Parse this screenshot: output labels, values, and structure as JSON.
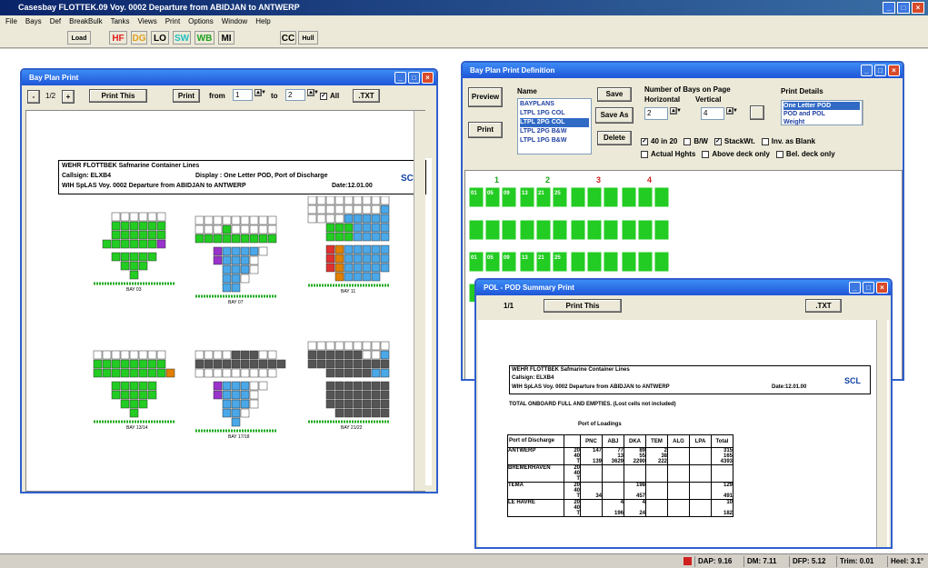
{
  "app": {
    "title": "Casesbay FLOTTEK.09  Voy. 0002 Departure from ABIDJAN to ANTWERP",
    "controls": [
      "_",
      "□",
      "×"
    ]
  },
  "menu": [
    "File",
    "Bays",
    "Def",
    "BreakBulk",
    "Tanks",
    "Views",
    "Print",
    "Options",
    "Window",
    "Help"
  ],
  "toolbar": {
    "load": "Load",
    "buttons": [
      {
        "label": "HF",
        "color": "#e02020"
      },
      {
        "label": "DG",
        "color": "#e0a020"
      },
      {
        "label": "LO",
        "color": "#000000"
      },
      {
        "label": "SW",
        "color": "#20c0c0"
      },
      {
        "label": "WB",
        "color": "#20a020"
      },
      {
        "label": "MI",
        "color": "#000000"
      },
      {
        "label": "CC",
        "color": "#000000"
      },
      {
        "label": "Hull",
        "color": "#000000"
      }
    ]
  },
  "bay_plan_window": {
    "title": "Bay Plan Print",
    "page": "1/2",
    "print_this": "Print This",
    "print": "Print",
    "from_label": "from",
    "from_value": "1",
    "to_label": "to",
    "to_value": "2",
    "all_label": "All",
    "txt": ".TXT",
    "header": {
      "ship": "WEHR FLOTTBEK   Safmarine Container Lines",
      "callsign": "Callsign: ELXB4",
      "display": "Display : One Letter POD, Port of Discharge",
      "voyage": "WIH SpLAS  Voy. 0002  Departure from ABIDJAN  to ANTWERP",
      "date": "Date:12.01.00",
      "logo": "SCL"
    },
    "bay_labels_top": [
      "BAY 01/02",
      "BAY 05/06",
      "BAY 09/10"
    ],
    "bay_labels_mid": [
      "BAY 03",
      "BAY 07",
      "BAY 11"
    ],
    "bay_labels_bottom": [
      "BAY 13/14",
      "BAY 17/18",
      "BAY 21/22"
    ]
  },
  "definition_window": {
    "title": "Bay Plan Print Definition",
    "preview": "Preview",
    "print": "Print",
    "name_label": "Name",
    "names": [
      "BAYPLANS",
      "LTPL 1PG COL",
      "LTPL 2PG COL",
      "LTPL 2PG B&W",
      "LTPL 1PG B&W"
    ],
    "selected_name": "LTPL 2PG COL",
    "save": "Save",
    "save_as": "Save As",
    "delete": "Delete",
    "bays_heading": "Number of Bays on Page",
    "horizontal_label": "Horizontal",
    "vertical_label": "Vertical",
    "horizontal_value": "2",
    "vertical_value": "4",
    "print_details_label": "Print Details",
    "print_details": [
      "One Letter POD",
      "POD and POL",
      "Weight"
    ],
    "selected_detail": "One Letter POD",
    "checkboxes": [
      {
        "label": "40 in 20",
        "checked": true
      },
      {
        "label": "B/W",
        "checked": false
      },
      {
        "label": "StackWt.",
        "checked": true
      },
      {
        "label": "Inv. as Blank",
        "checked": false
      },
      {
        "label": "Actual Hghts",
        "checked": false
      },
      {
        "label": "Above deck only",
        "checked": false
      },
      {
        "label": "Bel. deck only",
        "checked": false
      }
    ],
    "page_numbers": [
      "1",
      "2",
      "3",
      "4"
    ],
    "cell_codes": [
      "01",
      "05",
      "09",
      "13",
      "21",
      "25",
      "29",
      "33",
      "02",
      "06",
      "10",
      "14",
      "22",
      "26",
      "30",
      "34"
    ]
  },
  "summary_window": {
    "title": "POL - POD Summary Print",
    "page": "1/1",
    "print_this": "Print This",
    "txt": ".TXT",
    "header": {
      "ship": "WEHR FLOTTBEK   Safmarine Container Lines",
      "callsign": "Callsign: ELXB4",
      "voyage": "WIH SpLAS  Voy. 0002  Departure from ABIDJAN   to ANTWERP",
      "date": "Date:12.01.00",
      "logo": "SCL"
    },
    "total_line": "TOTAL ONBOARD   FULL AND EMPTIES.  (Lost cells not included)",
    "loading_label": "Port of Loadings",
    "discharge_label": "Port of Discharge",
    "columns": [
      "PNC",
      "ABJ",
      "DKA",
      "TEM",
      "ALG",
      "LPA",
      "Total"
    ],
    "rows": [
      {
        "port": "ANTWERP",
        "sizes": [
          "20",
          "40",
          "T"
        ],
        "PNC": [
          "147",
          "",
          "139"
        ],
        "ABJ": [
          "77",
          "13",
          "3629"
        ],
        "DKA": [
          "89",
          "55",
          "2290"
        ],
        "TEM": [
          "2",
          "38",
          "222"
        ],
        "ALG": [
          "",
          "",
          ""
        ],
        "LPA": [
          "",
          "",
          ""
        ],
        "Total": [
          "315",
          "165",
          "4393"
        ]
      },
      {
        "port": "BREMERHAVEN",
        "sizes": [
          "20",
          "40",
          "T"
        ],
        "PNC": [
          "",
          "",
          ""
        ],
        "ABJ": [
          "",
          "",
          ""
        ],
        "DKA": [
          "",
          "",
          ""
        ],
        "TEM": [
          "",
          "",
          ""
        ],
        "ALG": [
          "",
          "",
          ""
        ],
        "LPA": [
          "",
          "",
          ""
        ],
        "Total": [
          "",
          "",
          ""
        ]
      },
      {
        "port": "TEMA",
        "sizes": [
          "20",
          "40",
          "T"
        ],
        "PNC": [
          "",
          "",
          "34"
        ],
        "ABJ": [
          "",
          "",
          ""
        ],
        "DKA": [
          "198",
          "",
          "457"
        ],
        "TEM": [
          "",
          "",
          ""
        ],
        "ALG": [
          "",
          "",
          ""
        ],
        "LPA": [
          "",
          "",
          ""
        ],
        "Total": [
          "129",
          "",
          "491"
        ]
      },
      {
        "port": "LE HAVRE",
        "sizes": [
          "20",
          "40",
          "T"
        ],
        "PNC": [
          "",
          "",
          ""
        ],
        "ABJ": [
          "4",
          "",
          "196"
        ],
        "DKA": [
          "4",
          "",
          "24"
        ],
        "TEM": [
          "",
          "",
          ""
        ],
        "ALG": [
          "",
          "",
          ""
        ],
        "LPA": [
          "",
          "",
          ""
        ],
        "Total": [
          "10",
          "",
          "182"
        ]
      }
    ]
  },
  "statusbar": [
    {
      "label": "DAP: 9.16"
    },
    {
      "label": "DM: 7.11"
    },
    {
      "label": "DFP: 5.12"
    },
    {
      "label": "Trim: 0.01"
    },
    {
      "label": "Heel: 3.1°"
    }
  ]
}
